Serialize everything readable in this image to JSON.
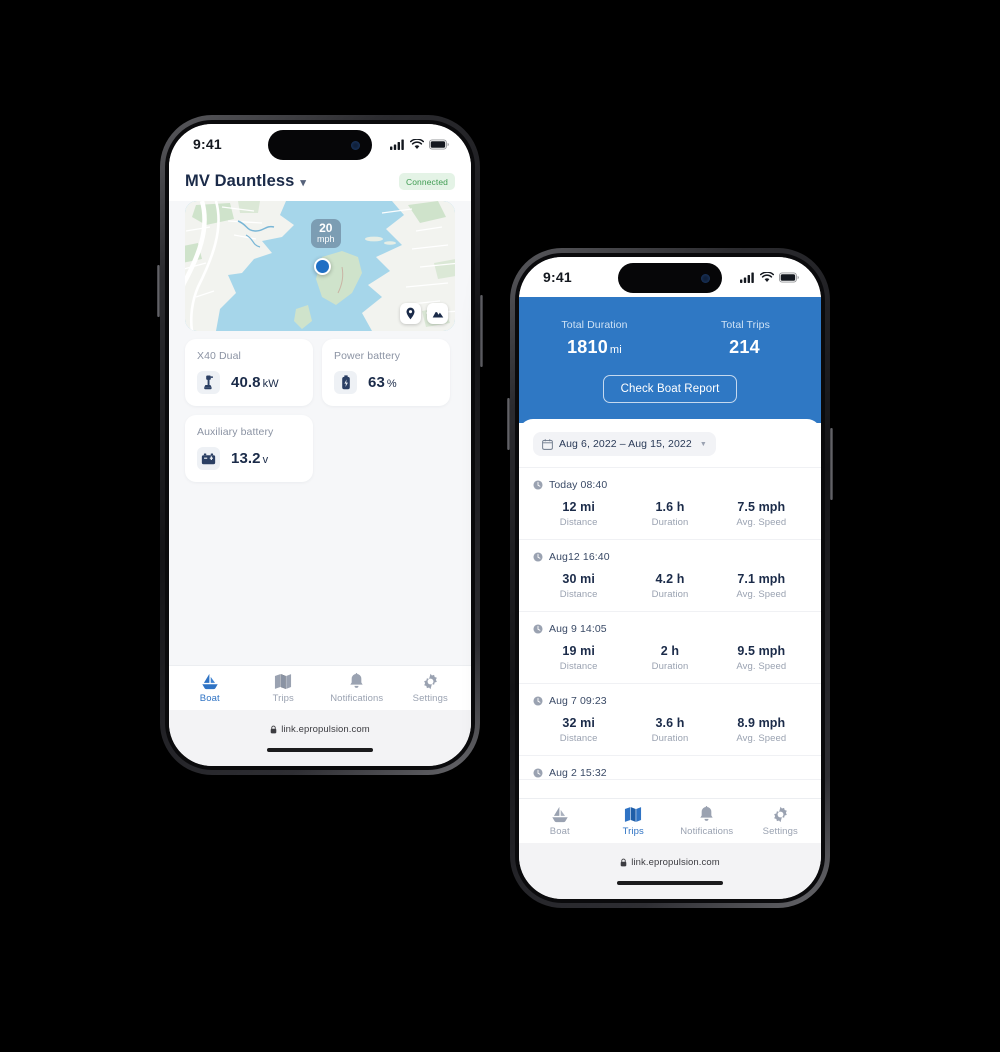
{
  "left_phone": {
    "status_bar": {
      "time": "9:41",
      "cellular_icon": "signal-bars-icon",
      "wifi_icon": "wifi-icon",
      "battery_icon": "battery-icon"
    },
    "header": {
      "boat_name": "MV Dauntless",
      "chevron_icon": "chevron-down-icon",
      "status_badge": "Connected",
      "status_badge_bg": "#e4f3e6",
      "status_badge_color": "#3f9c52"
    },
    "map": {
      "speed_value": "20",
      "speed_unit": "mph",
      "boat_marker_icon": "boat-position-dot",
      "controls": [
        {
          "icon": "location-pin-icon"
        },
        {
          "icon": "map-layers-icon"
        }
      ],
      "water_color": "#a6d6ea",
      "land_color": "#f2f3ef",
      "park_color": "#cfe3cb"
    },
    "cards": [
      {
        "label": "X40 Dual",
        "icon": "outboard-motor-icon",
        "value": "40.8",
        "unit": "kW"
      },
      {
        "label": "Power battery",
        "icon": "battery-vertical-icon",
        "value": "63",
        "unit": "%"
      },
      {
        "label": "Auxiliary battery",
        "icon": "car-battery-icon",
        "value": "13.2",
        "unit": "v"
      }
    ],
    "tabs": [
      {
        "label": "Boat",
        "icon": "sailboat-icon",
        "active": true
      },
      {
        "label": "Trips",
        "icon": "map-fold-icon",
        "active": false
      },
      {
        "label": "Notifications",
        "icon": "bell-icon",
        "active": false
      },
      {
        "label": "Settings",
        "icon": "gear-icon",
        "active": false
      }
    ],
    "browser": {
      "lock_icon": "lock-icon",
      "url": "link.epropulsion.com"
    }
  },
  "right_phone": {
    "status_bar": {
      "time": "9:41",
      "cellular_icon": "signal-bars-icon",
      "wifi_icon": "wifi-icon",
      "battery_icon": "battery-icon"
    },
    "hero": {
      "bg_color": "#2f78c4",
      "stats": [
        {
          "label": "Total Duration",
          "value": "1810",
          "unit": "mi"
        },
        {
          "label": "Total Trips",
          "value": "214",
          "unit": ""
        }
      ],
      "button_label": "Check Boat Report"
    },
    "date_filter": {
      "calendar_icon": "calendar-icon",
      "text": "Aug 6, 2022  –  Aug 15, 2022",
      "caret_icon": "chevron-down-icon"
    },
    "trips": [
      {
        "time": "Today 08:40",
        "clock_icon": "clock-icon",
        "distance": "12 mi",
        "duration": "1.6 h",
        "speed": "7.5 mph"
      },
      {
        "time": "Aug12 16:40",
        "clock_icon": "clock-icon",
        "distance": "30 mi",
        "duration": "4.2 h",
        "speed": "7.1 mph"
      },
      {
        "time": "Aug 9 14:05",
        "clock_icon": "clock-icon",
        "distance": "19 mi",
        "duration": "2 h",
        "speed": "9.5 mph"
      },
      {
        "time": "Aug 7 09:23",
        "clock_icon": "clock-icon",
        "distance": "32 mi",
        "duration": "3.6 h",
        "speed": "8.9 mph"
      },
      {
        "time": "Aug 2 15:32",
        "clock_icon": "clock-icon",
        "distance": "",
        "duration": "",
        "speed": ""
      }
    ],
    "metric_labels": {
      "distance": "Distance",
      "duration": "Duration",
      "speed": "Avg. Speed"
    },
    "tabs": [
      {
        "label": "Boat",
        "icon": "sailboat-icon",
        "active": false
      },
      {
        "label": "Trips",
        "icon": "map-fold-icon",
        "active": true
      },
      {
        "label": "Notifications",
        "icon": "bell-icon",
        "active": false
      },
      {
        "label": "Settings",
        "icon": "gear-icon",
        "active": false
      }
    ],
    "browser": {
      "lock_icon": "lock-icon",
      "url": "link.epropulsion.com"
    }
  }
}
